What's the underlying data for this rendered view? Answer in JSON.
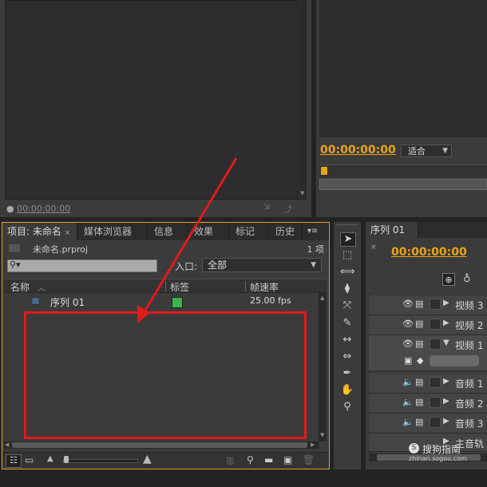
{
  "source_monitor": {
    "timecode": "00:00:00:00"
  },
  "program_monitor": {
    "timecode": "00:00:00:00",
    "fit_select": "适合"
  },
  "project_panel": {
    "tabs": [
      "项目: 未命名",
      "媒体浏览器",
      "信息",
      "效果",
      "标记",
      "历史"
    ],
    "project_file": "未命名.prproj",
    "item_count": "1 项",
    "search_placeholder": "",
    "entry_label": "入口:",
    "entry_value": "全部",
    "columns": {
      "name": "名称",
      "label": "标签",
      "frame_rate": "帧速率"
    },
    "rows": [
      {
        "name": "序列 01",
        "label_color": "#3cb44b",
        "frame_rate": "25.00 fps"
      }
    ]
  },
  "sequence_panel": {
    "tab": "序列 01",
    "timecode": "00:00:00:00",
    "tracks": [
      {
        "type": "video",
        "name": "视频 3"
      },
      {
        "type": "video",
        "name": "视频 2"
      },
      {
        "type": "video",
        "name": "视频 1"
      },
      {
        "type": "audio",
        "name": "音频 1"
      },
      {
        "type": "audio",
        "name": "音频 2"
      },
      {
        "type": "audio",
        "name": "音频 3"
      },
      {
        "type": "master",
        "name": "主音轨"
      }
    ]
  },
  "watermark": {
    "text": "搜狗指南",
    "url": "zhinan.sogou.com"
  },
  "colors": {
    "accent": "#e8a317",
    "annotation": "#e01b1b"
  }
}
